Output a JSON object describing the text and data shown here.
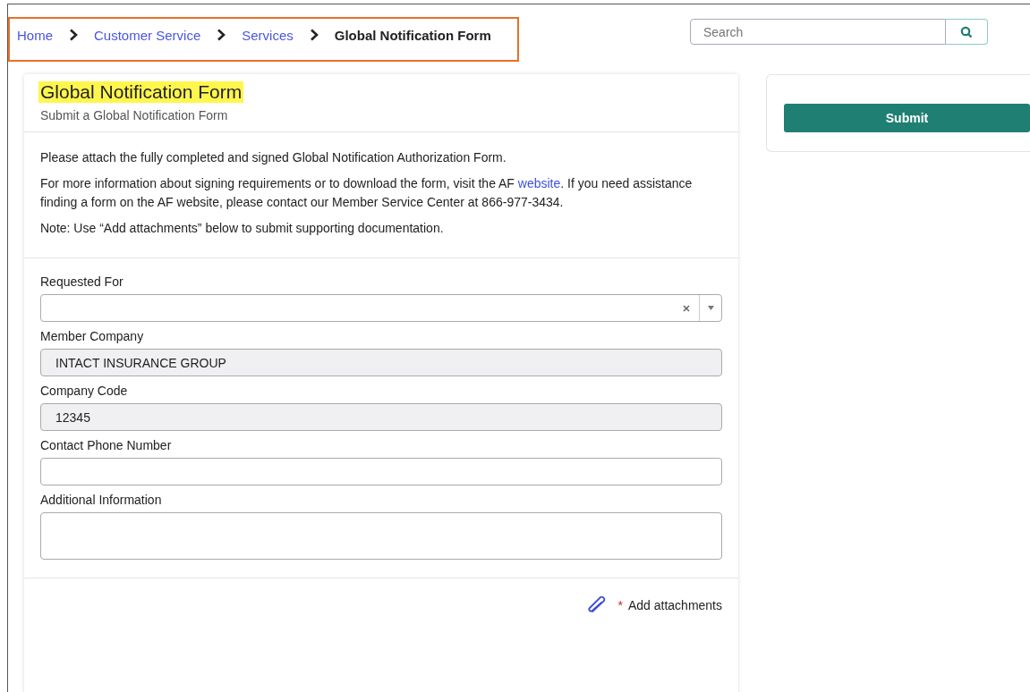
{
  "breadcrumb": [
    {
      "label": "Home",
      "current": false
    },
    {
      "label": "Customer Service",
      "current": false
    },
    {
      "label": "Services",
      "current": false
    },
    {
      "label": "Global Notification Form",
      "current": true
    }
  ],
  "search": {
    "placeholder": "Search"
  },
  "form": {
    "title": "Global Notification Form",
    "subtitle": "Submit a Global Notification Form",
    "instructions": [
      {
        "text": "Please attach the fully completed and signed Global Notification Authorization Form."
      },
      {
        "text": "For more information about signing requirements or to download the form, visit the AF ",
        "link": "website",
        "after": ". If you need assistance finding a form on the AF website, please contact our Member Service Center at 866-977-3434."
      },
      {
        "text": "Note: Use “Add attachments” below to submit supporting documentation."
      }
    ],
    "fields": [
      {
        "kind": "select",
        "label": "Requested For"
      },
      {
        "kind": "readonly",
        "label": "Member Company",
        "value": "INTACT INSURANCE GROUP"
      },
      {
        "kind": "readonly",
        "label": "Company Code",
        "value": "12345"
      },
      {
        "kind": "text",
        "label": "Contact Phone Number"
      },
      {
        "kind": "textarea",
        "label": "Additional Information"
      }
    ],
    "attachments": {
      "marker": "*",
      "label": "Add attachments"
    }
  },
  "submit": {
    "label": "Submit"
  }
}
